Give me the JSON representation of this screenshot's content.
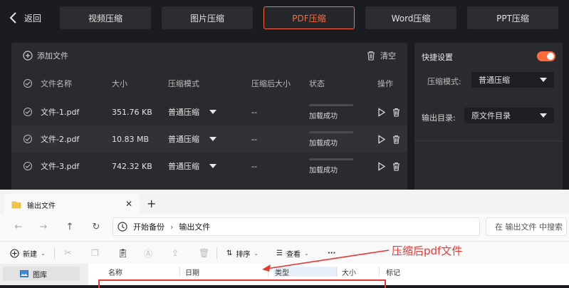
{
  "nav": {
    "back_label": "返回",
    "tabs": [
      {
        "label": "视频压缩",
        "active": false
      },
      {
        "label": "图片压缩",
        "active": false
      },
      {
        "label": "PDF压缩",
        "active": true
      },
      {
        "label": "Word压缩",
        "active": false
      },
      {
        "label": "PPT压缩",
        "active": false
      }
    ]
  },
  "file_panel": {
    "add_label": "添加文件",
    "clear_label": "清空",
    "headers": [
      "文件名称",
      "大小",
      "压缩模式",
      "压缩后大小",
      "状态",
      "操作"
    ],
    "rows": [
      {
        "name": "文件-1.pdf",
        "size": "351.76 KB",
        "mode": "普通压缩",
        "after": "--",
        "status": "加载成功"
      },
      {
        "name": "文件-2.pdf",
        "size": "10.83 MB",
        "mode": "普通压缩",
        "after": "--",
        "status": "加载成功"
      },
      {
        "name": "文件-3.pdf",
        "size": "742.32 KB",
        "mode": "普通压缩",
        "after": "--",
        "status": "加载成功"
      }
    ]
  },
  "settings": {
    "title": "快捷设置",
    "toggle_on": true,
    "mode_label": "压缩模式:",
    "mode_value": "普通压缩",
    "output_label": "输出目录:",
    "output_value": "原文件目录"
  },
  "explorer": {
    "tab_title": "输出文件",
    "breadcrumb": [
      "开始备份",
      "输出文件"
    ],
    "search_placeholder": "在 输出文件 中搜索",
    "toolbar": {
      "new": "新建",
      "sort": "排序",
      "view": "查看",
      "more": "···"
    },
    "sidebar_item": "图库",
    "columns": [
      "名称",
      "日期",
      "类型",
      "大小",
      "标记"
    ]
  },
  "annotation": {
    "text": "压缩后pdf文件",
    "color": "#e53935"
  },
  "colors": {
    "accent": "#ff6a3d",
    "panel": "#2a2b2e"
  }
}
